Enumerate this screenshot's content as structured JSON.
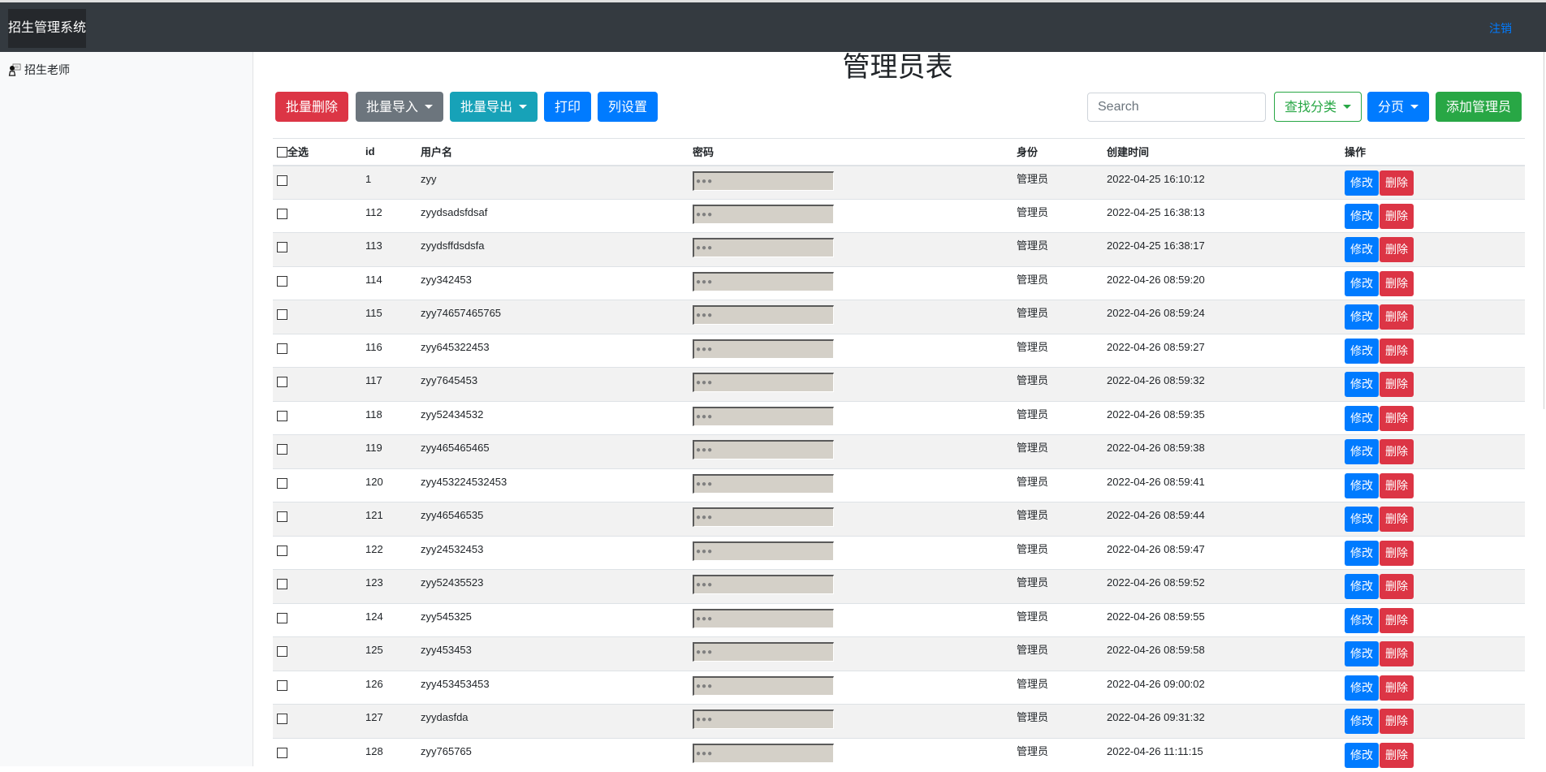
{
  "app": {
    "brand": "招生管理系统",
    "logout_label": "注销"
  },
  "sidebar": {
    "items": [
      {
        "label": "招生老师",
        "icon": "teacher-icon"
      }
    ]
  },
  "page": {
    "title": "管理员表"
  },
  "toolbar": {
    "batch_delete": "批量删除",
    "batch_import": "批量导入",
    "batch_export": "批量导出",
    "print": "打印",
    "column_settings": "列设置",
    "search_placeholder": "Search",
    "search_value": "",
    "search_category": "查找分类",
    "pagination": "分页",
    "add_admin": "添加管理员"
  },
  "colors": {
    "danger": "#dc3545",
    "secondary": "#6c757d",
    "info": "#17a2b8",
    "primary": "#007bff",
    "success": "#28a745",
    "topbar": "#343a40"
  },
  "table": {
    "columns": [
      "全选",
      "id",
      "用户名",
      "密码",
      "身份",
      "创建时间",
      "操作"
    ],
    "edit_label": "修改",
    "delete_label": "删除",
    "password_mask": "●●●",
    "rows": [
      {
        "id": "1",
        "username": "zyy",
        "role": "管理员",
        "created": "2022-04-25 16:10:12"
      },
      {
        "id": "112",
        "username": "zyydsadsfdsaf",
        "role": "管理员",
        "created": "2022-04-25 16:38:13"
      },
      {
        "id": "113",
        "username": "zyydsffdsdsfa",
        "role": "管理员",
        "created": "2022-04-25 16:38:17"
      },
      {
        "id": "114",
        "username": "zyy342453",
        "role": "管理员",
        "created": "2022-04-26 08:59:20"
      },
      {
        "id": "115",
        "username": "zyy74657465765",
        "role": "管理员",
        "created": "2022-04-26 08:59:24"
      },
      {
        "id": "116",
        "username": "zyy645322453",
        "role": "管理员",
        "created": "2022-04-26 08:59:27"
      },
      {
        "id": "117",
        "username": "zyy7645453",
        "role": "管理员",
        "created": "2022-04-26 08:59:32"
      },
      {
        "id": "118",
        "username": "zyy52434532",
        "role": "管理员",
        "created": "2022-04-26 08:59:35"
      },
      {
        "id": "119",
        "username": "zyy465465465",
        "role": "管理员",
        "created": "2022-04-26 08:59:38"
      },
      {
        "id": "120",
        "username": "zyy453224532453",
        "role": "管理员",
        "created": "2022-04-26 08:59:41"
      },
      {
        "id": "121",
        "username": "zyy46546535",
        "role": "管理员",
        "created": "2022-04-26 08:59:44"
      },
      {
        "id": "122",
        "username": "zyy24532453",
        "role": "管理员",
        "created": "2022-04-26 08:59:47"
      },
      {
        "id": "123",
        "username": "zyy52435523",
        "role": "管理员",
        "created": "2022-04-26 08:59:52"
      },
      {
        "id": "124",
        "username": "zyy545325",
        "role": "管理员",
        "created": "2022-04-26 08:59:55"
      },
      {
        "id": "125",
        "username": "zyy453453",
        "role": "管理员",
        "created": "2022-04-26 08:59:58"
      },
      {
        "id": "126",
        "username": "zyy453453453",
        "role": "管理员",
        "created": "2022-04-26 09:00:02"
      },
      {
        "id": "127",
        "username": "zyydasfda",
        "role": "管理员",
        "created": "2022-04-26 09:31:32"
      },
      {
        "id": "128",
        "username": "zyy765765",
        "role": "管理员",
        "created": "2022-04-26 11:11:15"
      }
    ]
  }
}
